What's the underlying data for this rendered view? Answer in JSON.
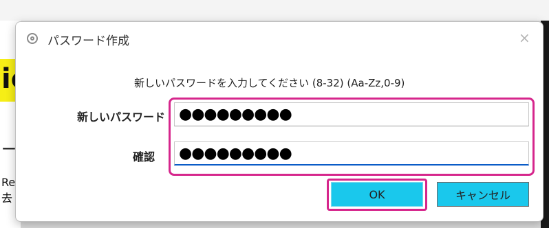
{
  "dialog": {
    "title": "パスワード作成",
    "close_label": "×",
    "instruction": "新しいパスワードを入力してください (8-32) (Aa-Zz,0-9)",
    "new_password": {
      "label": "新しいパスワード",
      "value": "●●●●●●●●●"
    },
    "confirm": {
      "label": "確認",
      "value": "●●●●●●●●●"
    },
    "ok_label": "OK",
    "cancel_label": "キャンセル"
  },
  "background": {
    "top_text": "ic",
    "left_glyph_1": "ic",
    "left_glyph_2": "ー",
    "left_glyph_3": "Re",
    "left_glyph_4": "去"
  },
  "colors": {
    "highlight": "#d6268c",
    "button": "#1ac8ec",
    "focus_underline": "#0a5cc7",
    "background_yellow": "#f6ee16"
  }
}
